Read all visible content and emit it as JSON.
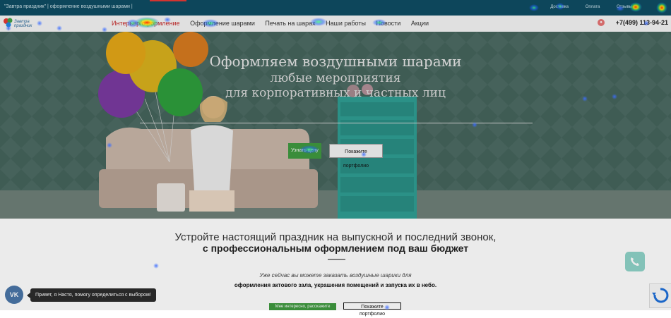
{
  "topbar": {
    "title": "\"Завтра праздник\" | оформление воздушными шарами |",
    "links": [
      "Доставка",
      "Оплата",
      "Отзывы"
    ]
  },
  "nav": {
    "logo_text": "Завтра\nпраздник",
    "items": [
      "Интерьер/оформление",
      "Оформление шарами",
      "Печать на шарах",
      "Наши работы",
      "Новости",
      "Акции"
    ],
    "phone": "+7(499) 113-94-21"
  },
  "hero": {
    "title": "Оформляем воздушными шарами",
    "subtitle1": "любые мероприятия",
    "subtitle2": "для корпоративных и частных лиц",
    "btn_order": "Узнать цену",
    "btn_portfolio": "Покажите портфолио"
  },
  "section": {
    "heading1": "Устройте настоящий праздник на выпускной и последний звонок,",
    "heading2": "с профессиональным оформлением под ваш бюджет",
    "text1": "Уже сейчас вы можете заказать воздушные шарики для",
    "text2": "оформления актового зала, украшения помещений и запуска их в небо.",
    "btn_order": "Мне интересно, расскажите",
    "btn_portfolio": "Покажите портфолио"
  },
  "widgets": {
    "vk_label": "VK",
    "chat_text": "Привет, я Настя, помогу определиться с выбором!"
  },
  "colors": {
    "topbar": "#0f4d63",
    "green": "#3f9a3f",
    "accent_red": "#c62828"
  }
}
